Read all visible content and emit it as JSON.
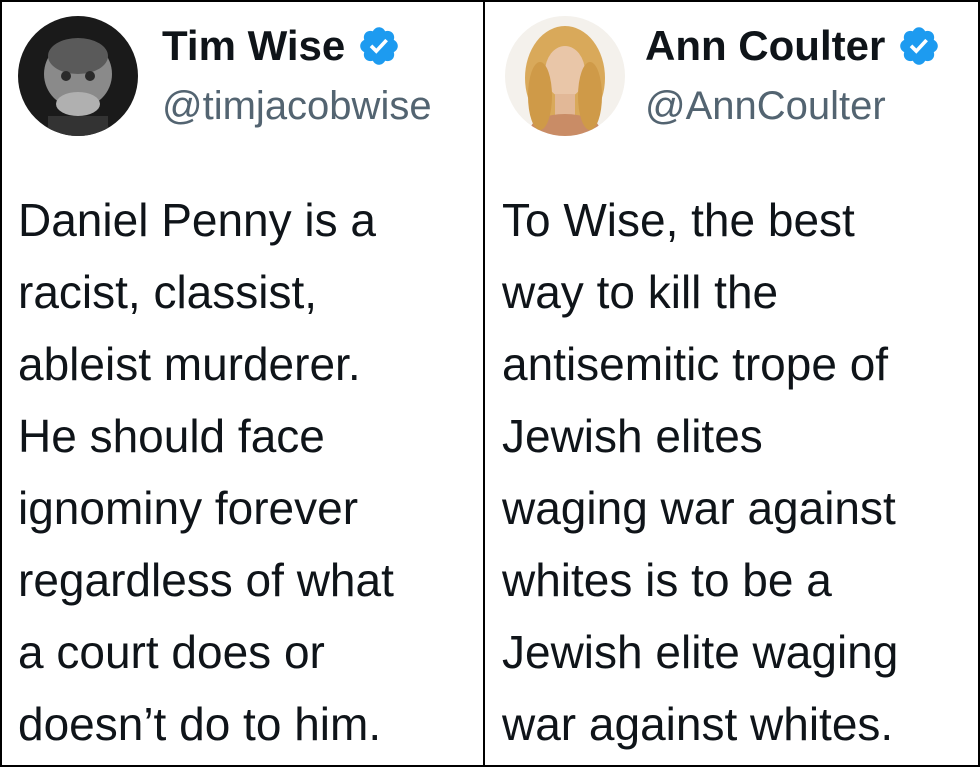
{
  "colors": {
    "verified_badge": "#1d9bf0",
    "name_text": "#0f1419",
    "handle_text": "#536471",
    "border": "#000000"
  },
  "tweets": [
    {
      "author": {
        "display_name": "Tim Wise",
        "handle": "@timjacobwise",
        "verified": true,
        "avatar_icon": "profile-photo-grayscale-man"
      },
      "lines": [
        "Daniel Penny is a",
        "racist, classist,",
        "ableist murderer.",
        "He should face",
        "ignominy forever",
        "regardless of what",
        "a court does or",
        "doesn’t do to him."
      ]
    },
    {
      "author": {
        "display_name": "Ann Coulter",
        "handle": "@AnnCoulter",
        "verified": true,
        "avatar_icon": "profile-photo-blonde-woman"
      },
      "lines": [
        "To Wise, the best",
        "way to kill the",
        "antisemitic trope of",
        "Jewish elites",
        "waging war against",
        "whites is to be a",
        "Jewish elite waging",
        "war against whites."
      ]
    }
  ]
}
